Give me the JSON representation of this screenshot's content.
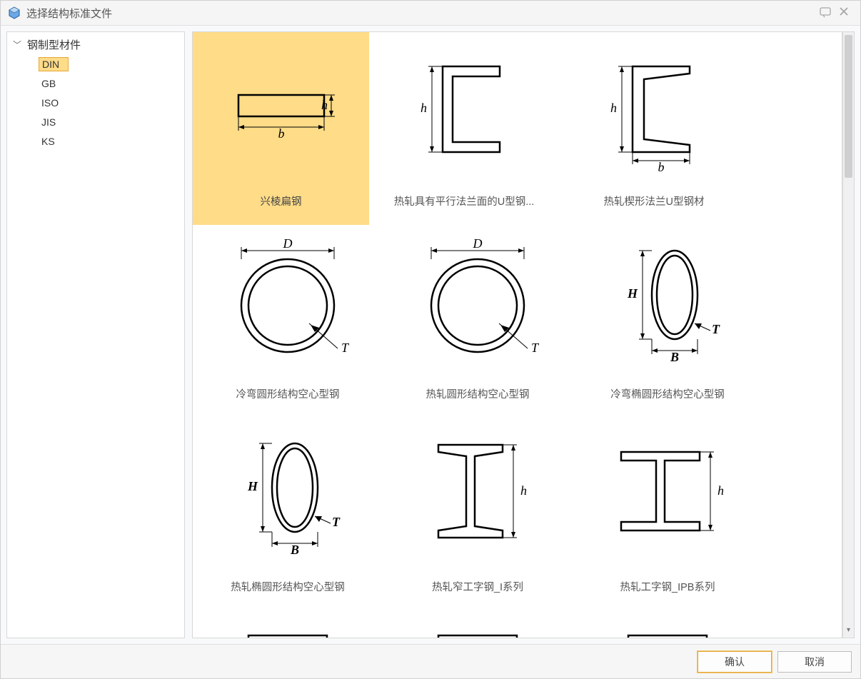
{
  "window": {
    "title": "选择结构标准文件"
  },
  "tree": {
    "root_label": "钢制型材件",
    "items": [
      {
        "label": "DIN",
        "selected": true
      },
      {
        "label": "GB",
        "selected": false
      },
      {
        "label": "ISO",
        "selected": false
      },
      {
        "label": "JIS",
        "selected": false
      },
      {
        "label": "KS",
        "selected": false
      }
    ]
  },
  "profiles": [
    {
      "label": "兴棱扁钢",
      "icon": "flat-bar",
      "selected": true
    },
    {
      "label": "热轧具有平行法兰面的U型钢...",
      "icon": "u-parallel",
      "selected": false
    },
    {
      "label": "热轧楔形法兰U型钢材",
      "icon": "u-tapered",
      "selected": false
    },
    {
      "label": "冷弯圆形结构空心型钢",
      "icon": "circle-hollow",
      "selected": false
    },
    {
      "label": "热轧圆形结构空心型钢",
      "icon": "circle-hollow",
      "selected": false
    },
    {
      "label": "冷弯椭圆形结构空心型钢",
      "icon": "ellipse-hollow",
      "selected": false
    },
    {
      "label": "热轧椭圆形结构空心型钢",
      "icon": "ellipse-hollow",
      "selected": false
    },
    {
      "label": "热轧窄工字钢_I系列",
      "icon": "i-narrow",
      "selected": false
    },
    {
      "label": "热轧工字钢_IPB系列",
      "icon": "i-wide",
      "selected": false
    }
  ],
  "buttons": {
    "ok": "确认",
    "cancel": "取消"
  }
}
